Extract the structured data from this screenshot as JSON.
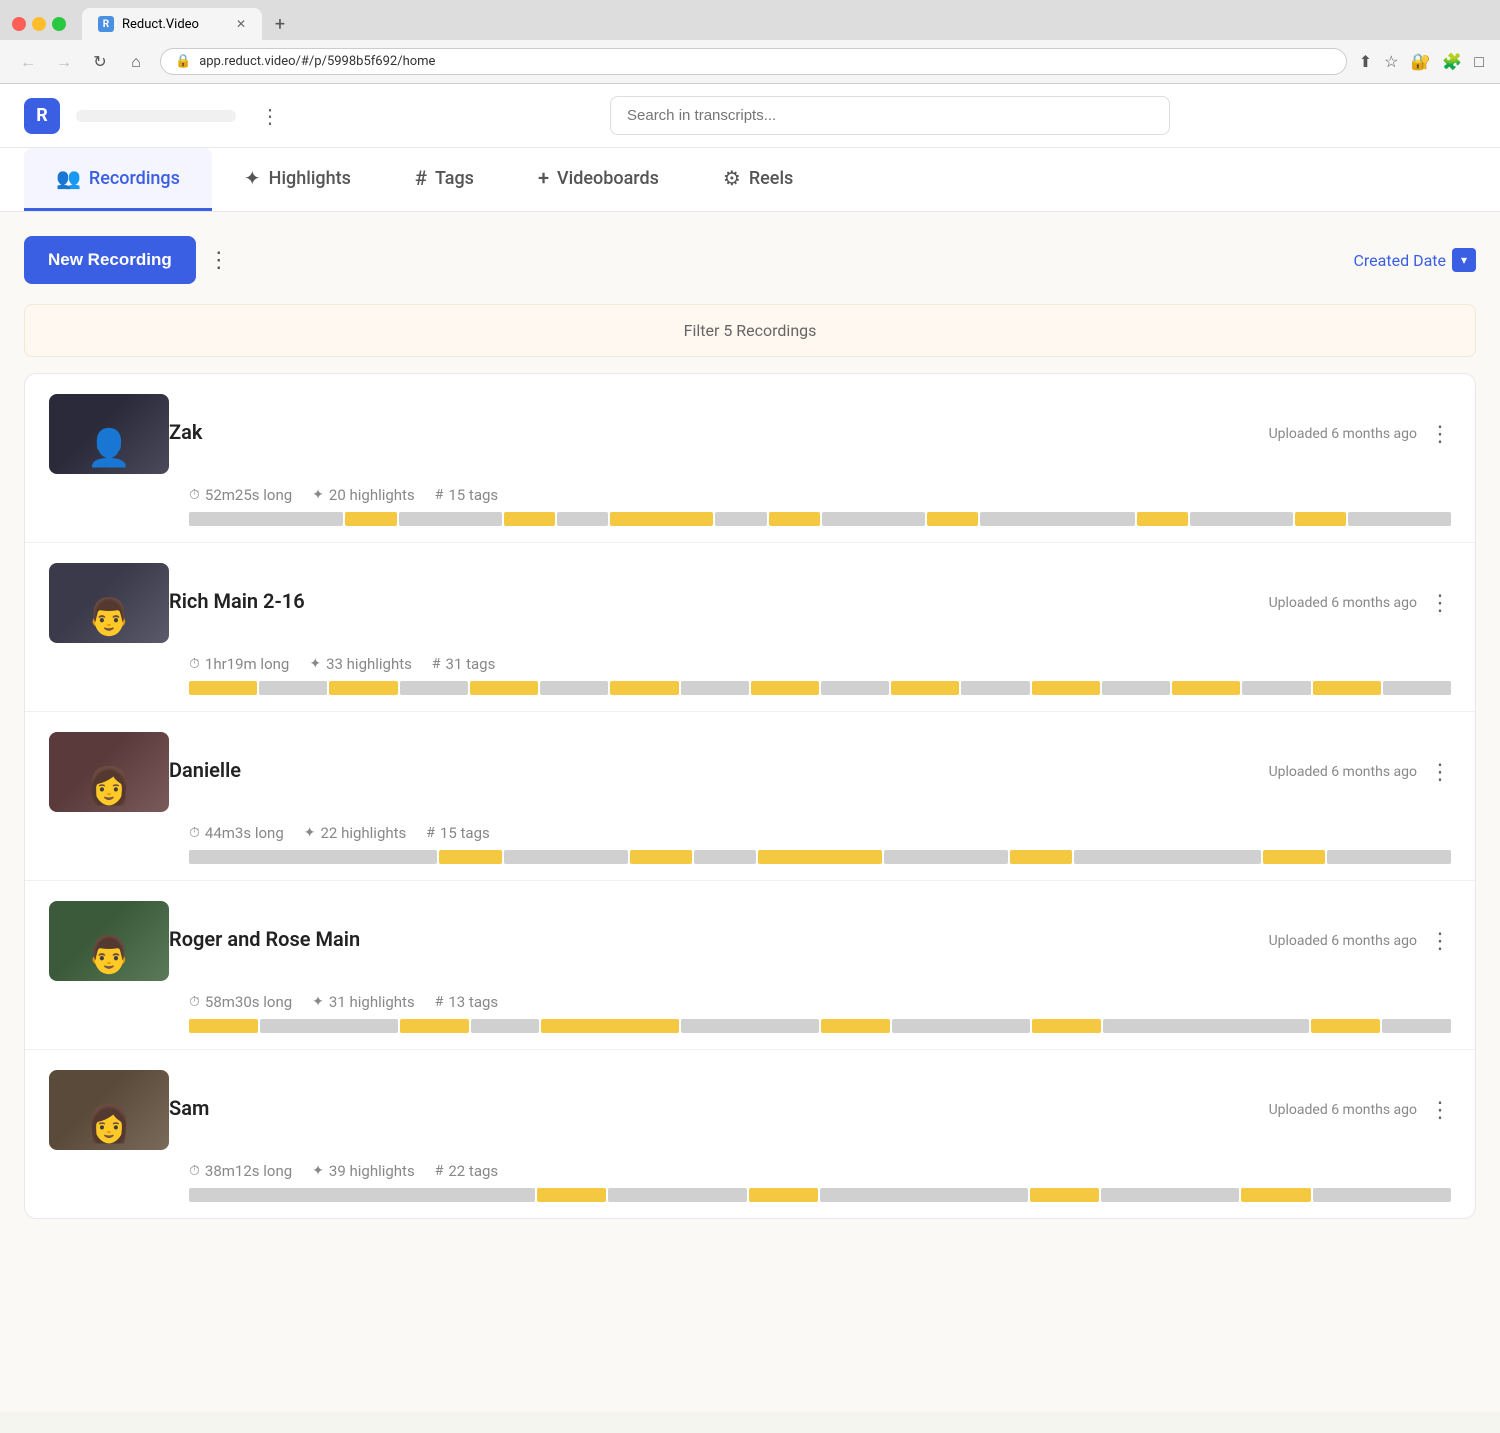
{
  "browser": {
    "tab_title": "Reduct.Video",
    "url": "app.reduct.video/#/p/5998b5f692/home",
    "new_tab_label": "+"
  },
  "header": {
    "workspace_name": "                ",
    "search_placeholder": "Search in transcripts...",
    "more_icon": "⋮"
  },
  "nav": {
    "tabs": [
      {
        "id": "recordings",
        "label": "Recordings",
        "icon": "👥",
        "active": true
      },
      {
        "id": "highlights",
        "label": "Highlights",
        "icon": "✨",
        "active": false
      },
      {
        "id": "tags",
        "label": "Tags",
        "icon": "#",
        "active": false
      },
      {
        "id": "videoboards",
        "label": "Videoboards",
        "icon": "+",
        "active": false
      },
      {
        "id": "reels",
        "label": "Reels",
        "icon": "⚙",
        "active": false
      }
    ]
  },
  "toolbar": {
    "new_recording_label": "New Recording",
    "sort_label": "Created Date",
    "more_icon": "⋮"
  },
  "filter_bar": {
    "text": "Filter 5 Recordings"
  },
  "recordings": [
    {
      "id": "zak",
      "name": "Zak",
      "upload_status": "Uploaded 6 months ago",
      "duration": "52m25s long",
      "highlights": "20 highlights",
      "tags": "15 tags",
      "thumb_class": "thumb-zak",
      "timeline": [
        {
          "type": "gray",
          "flex": 3
        },
        {
          "type": "yellow",
          "flex": 1
        },
        {
          "type": "gray",
          "flex": 2
        },
        {
          "type": "yellow",
          "flex": 1
        },
        {
          "type": "gray",
          "flex": 1
        },
        {
          "type": "yellow",
          "flex": 2
        },
        {
          "type": "gray",
          "flex": 1
        },
        {
          "type": "yellow",
          "flex": 1
        },
        {
          "type": "gray",
          "flex": 2
        },
        {
          "type": "yellow",
          "flex": 1
        },
        {
          "type": "gray",
          "flex": 3
        },
        {
          "type": "yellow",
          "flex": 1
        },
        {
          "type": "gray",
          "flex": 2
        },
        {
          "type": "yellow",
          "flex": 1
        },
        {
          "type": "gray",
          "flex": 2
        }
      ]
    },
    {
      "id": "rich",
      "name": "Rich Main 2-16",
      "upload_status": "Uploaded 6 months ago",
      "duration": "1hr19m long",
      "highlights": "33 highlights",
      "tags": "31 tags",
      "thumb_class": "thumb-rich",
      "timeline": [
        {
          "type": "yellow",
          "flex": 1
        },
        {
          "type": "gray",
          "flex": 1
        },
        {
          "type": "yellow",
          "flex": 1
        },
        {
          "type": "gray",
          "flex": 1
        },
        {
          "type": "yellow",
          "flex": 1
        },
        {
          "type": "gray",
          "flex": 1
        },
        {
          "type": "yellow",
          "flex": 1
        },
        {
          "type": "gray",
          "flex": 1
        },
        {
          "type": "yellow",
          "flex": 1
        },
        {
          "type": "gray",
          "flex": 1
        },
        {
          "type": "yellow",
          "flex": 1
        },
        {
          "type": "gray",
          "flex": 1
        },
        {
          "type": "yellow",
          "flex": 1
        },
        {
          "type": "gray",
          "flex": 1
        },
        {
          "type": "yellow",
          "flex": 1
        },
        {
          "type": "gray",
          "flex": 1
        },
        {
          "type": "yellow",
          "flex": 1
        },
        {
          "type": "gray",
          "flex": 1
        }
      ]
    },
    {
      "id": "danielle",
      "name": "Danielle",
      "upload_status": "Uploaded 6 months ago",
      "duration": "44m3s long",
      "highlights": "22 highlights",
      "tags": "15 tags",
      "thumb_class": "thumb-danielle",
      "timeline": [
        {
          "type": "gray",
          "flex": 4
        },
        {
          "type": "yellow",
          "flex": 1
        },
        {
          "type": "gray",
          "flex": 2
        },
        {
          "type": "yellow",
          "flex": 1
        },
        {
          "type": "gray",
          "flex": 1
        },
        {
          "type": "yellow",
          "flex": 2
        },
        {
          "type": "gray",
          "flex": 2
        },
        {
          "type": "yellow",
          "flex": 1
        },
        {
          "type": "gray",
          "flex": 3
        },
        {
          "type": "yellow",
          "flex": 1
        },
        {
          "type": "gray",
          "flex": 2
        }
      ]
    },
    {
      "id": "roger",
      "name": "Roger and Rose Main",
      "upload_status": "Uploaded 6 months ago",
      "duration": "58m30s long",
      "highlights": "31 highlights",
      "tags": "13 tags",
      "thumb_class": "thumb-roger",
      "timeline": [
        {
          "type": "yellow",
          "flex": 1
        },
        {
          "type": "gray",
          "flex": 2
        },
        {
          "type": "yellow",
          "flex": 1
        },
        {
          "type": "gray",
          "flex": 1
        },
        {
          "type": "yellow",
          "flex": 2
        },
        {
          "type": "gray",
          "flex": 2
        },
        {
          "type": "yellow",
          "flex": 1
        },
        {
          "type": "gray",
          "flex": 2
        },
        {
          "type": "yellow",
          "flex": 1
        },
        {
          "type": "gray",
          "flex": 3
        },
        {
          "type": "yellow",
          "flex": 1
        },
        {
          "type": "gray",
          "flex": 1
        }
      ]
    },
    {
      "id": "sam",
      "name": "Sam",
      "upload_status": "Uploaded 6 months ago",
      "duration": "38m12s long",
      "highlights": "39 highlights",
      "tags": "22 tags",
      "thumb_class": "thumb-sam",
      "timeline": [
        {
          "type": "gray",
          "flex": 5
        },
        {
          "type": "yellow",
          "flex": 1
        },
        {
          "type": "gray",
          "flex": 2
        },
        {
          "type": "yellow",
          "flex": 1
        },
        {
          "type": "gray",
          "flex": 3
        },
        {
          "type": "yellow",
          "flex": 1
        },
        {
          "type": "gray",
          "flex": 2
        },
        {
          "type": "yellow",
          "flex": 1
        },
        {
          "type": "gray",
          "flex": 2
        }
      ]
    }
  ],
  "icons": {
    "clock": "⏱",
    "highlight": "✦",
    "tag": "#",
    "more": "⋮",
    "sort_down": "▾",
    "back": "←",
    "forward": "→",
    "refresh": "↻",
    "home": "⌂",
    "share": "⬆",
    "star": "☆",
    "extension": "🧩",
    "lock": "🔒"
  },
  "colors": {
    "accent": "#3b5fe2",
    "yellow": "#f5c842",
    "gray_seg": "#d0d0d0",
    "filter_bg": "#fff8f0"
  }
}
